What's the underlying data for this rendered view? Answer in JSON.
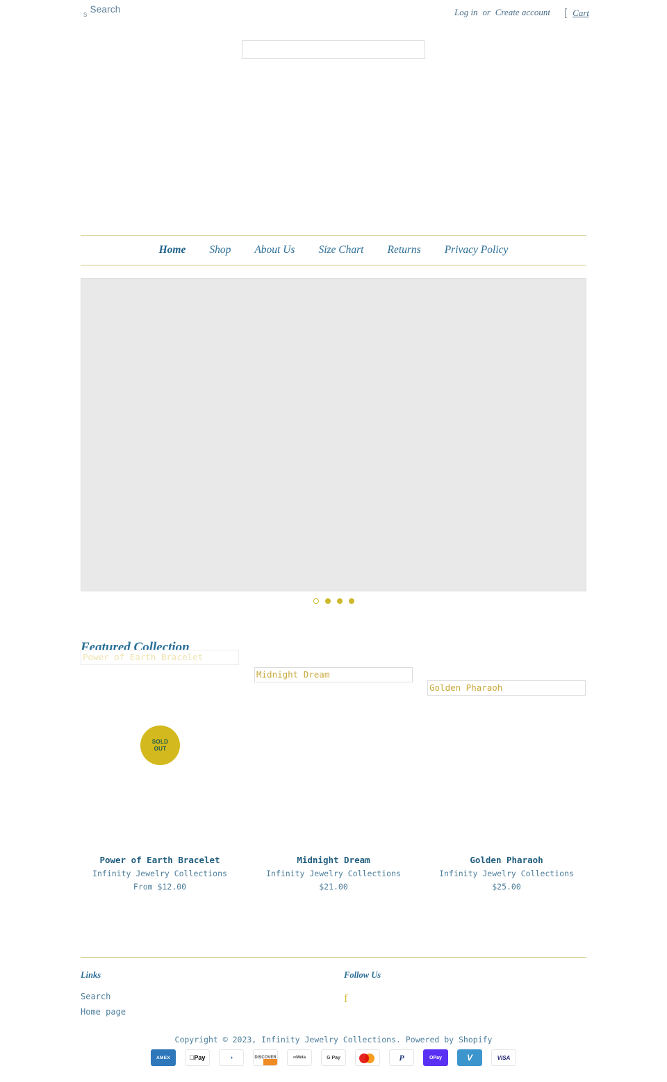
{
  "topbar": {
    "search_icon": "search-icon",
    "search_label": "Search",
    "login_label": "Log in",
    "or_label": "or",
    "create_account_label": "Create account",
    "cart_icon": "cart-icon",
    "cart_label": "Cart"
  },
  "search_form": {
    "value": "",
    "placeholder": ""
  },
  "nav": {
    "items": [
      {
        "label": "Home",
        "active": true
      },
      {
        "label": "Shop",
        "active": false
      },
      {
        "label": "About Us",
        "active": false
      },
      {
        "label": "Size Chart",
        "active": false
      },
      {
        "label": "Returns",
        "active": false
      },
      {
        "label": "Privacy Policy",
        "active": false
      }
    ]
  },
  "hero": {
    "slide_count": 4,
    "active_slide": 1
  },
  "featured": {
    "heading": "Featured Collection",
    "products": [
      {
        "image_alt": "Power of Earth Bracelet",
        "name": "Power of Earth Bracelet",
        "vendor": "Infinity Jewelry Collections",
        "price": "From $12.00",
        "badge": "SOLD\nOUT",
        "badge_line1": "SOLD",
        "badge_line2": "OUT",
        "sold_out": true
      },
      {
        "image_alt": "Midnight Dream",
        "name": "Midnight Dream",
        "vendor": "Infinity Jewelry Collections",
        "price": "$21.00",
        "sold_out": false
      },
      {
        "image_alt": "Golden Pharaoh",
        "name": "Golden Pharaoh",
        "vendor": "Infinity Jewelry Collections",
        "price": "$25.00",
        "sold_out": false
      }
    ]
  },
  "footer": {
    "links_heading": "Links",
    "links": [
      {
        "label": "Search"
      },
      {
        "label": "Home page"
      }
    ],
    "follow_heading": "Follow Us",
    "facebook_icon": "facebook-icon",
    "facebook_glyph": "f",
    "copyright": "Copyright © 2023, Infinity Jewelry Collections. Powered by Shopify",
    "payment_methods": [
      {
        "name": "american-express",
        "label": "AMEX"
      },
      {
        "name": "apple-pay",
        "label": "Pay"
      },
      {
        "name": "diners-club",
        "label": "()"
      },
      {
        "name": "discover",
        "label": "DISCOVER"
      },
      {
        "name": "meta-pay",
        "label": "Meta"
      },
      {
        "name": "google-pay",
        "label": "G Pay"
      },
      {
        "name": "mastercard",
        "label": ""
      },
      {
        "name": "paypal",
        "label": "P"
      },
      {
        "name": "shop-pay",
        "label": "OPay"
      },
      {
        "name": "venmo",
        "label": "V"
      },
      {
        "name": "visa",
        "label": "VISA"
      }
    ]
  },
  "colors": {
    "gold_rule": "#cdc87d",
    "accent_blue": "#2a7099",
    "badge_gold": "#d4b91e",
    "badge_text": "#1d5a4a"
  }
}
